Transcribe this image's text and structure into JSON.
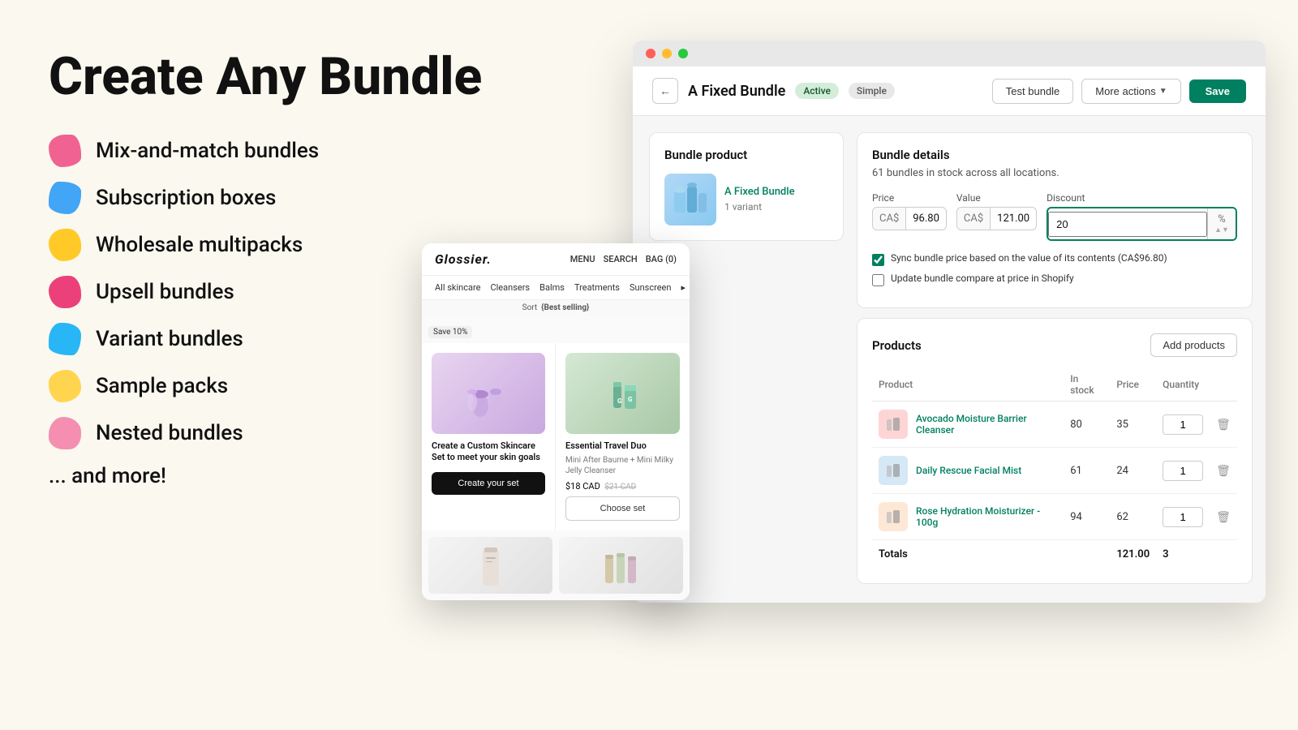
{
  "page": {
    "background_color": "#faf8ef"
  },
  "left": {
    "title": "Create Any Bundle",
    "features": [
      {
        "id": "mix-match",
        "label": "Mix-and-match bundles",
        "blob_class": "blob-pink"
      },
      {
        "id": "subscription",
        "label": "Subscription boxes",
        "blob_class": "blob-blue"
      },
      {
        "id": "wholesale",
        "label": "Wholesale multipacks",
        "blob_class": "blob-yellow"
      },
      {
        "id": "upsell",
        "label": "Upsell bundles",
        "blob_class": "blob-pink2"
      },
      {
        "id": "variant",
        "label": "Variant bundles",
        "blob_class": "blob-blue2"
      },
      {
        "id": "sample",
        "label": "Sample packs",
        "blob_class": "blob-yellow2"
      },
      {
        "id": "nested",
        "label": "Nested bundles",
        "blob_class": "blob-pink3"
      }
    ],
    "more_text": "... and more!"
  },
  "browser": {
    "window_dots": [
      "red",
      "yellow",
      "green"
    ]
  },
  "admin": {
    "title": "A Fixed Bundle",
    "badge_active": "Active",
    "badge_simple": "Simple",
    "btn_test": "Test bundle",
    "btn_more": "More actions",
    "btn_save": "Save",
    "bundle_product_section": {
      "title": "Bundle product",
      "product_name": "A Fixed Bundle",
      "product_variant": "1 variant"
    },
    "bundle_details": {
      "title": "Bundle details",
      "stock_info": "61 bundles in stock across all locations.",
      "price_label": "Price",
      "price_currency": "CA$",
      "price_value": "96.80",
      "value_label": "Value",
      "value_currency": "CA$",
      "value_value": "121.00",
      "discount_label": "Discount",
      "discount_value": "20",
      "discount_suffix": "%",
      "checkbox1_label": "Sync bundle price based on the value of its contents (CA$96.80)",
      "checkbox2_label": "Update bundle compare at price in Shopify"
    },
    "products": {
      "title": "Products",
      "btn_add": "Add products",
      "columns": [
        "Product",
        "In stock",
        "Price",
        "Quantity"
      ],
      "items": [
        {
          "name": "Avocado Moisture Barrier Cleanser",
          "in_stock": "80",
          "price": "35",
          "quantity": "1",
          "thumb_color": "#fdd5d5"
        },
        {
          "name": "Daily Rescue Facial Mist",
          "in_stock": "61",
          "price": "24",
          "quantity": "1",
          "thumb_color": "#d5e8f5"
        },
        {
          "name": "Rose Hydration Moisturizer - 100g",
          "in_stock": "94",
          "price": "62",
          "quantity": "1",
          "thumb_color": "#fde8d5"
        }
      ],
      "totals_label": "Totals",
      "totals_price": "121.00",
      "totals_qty": "3"
    }
  },
  "store_preview": {
    "logo": "Glossier.",
    "nav_links": [
      "MENU",
      "SEARCH",
      "BAG (0)"
    ],
    "categories": [
      "All skincare",
      "Cleansers",
      "Balms",
      "Treatments",
      "Sunscreen",
      "▸"
    ],
    "sort_label": "Sort",
    "sort_value": "Best selling",
    "save_badge": "Save 10%",
    "product1": {
      "title": "Create a Custom Skincare Set to meet your skin goals",
      "button": "Create your set"
    },
    "product2": {
      "title": "Essential Travel Duo",
      "subtitle": "Mini After Baume + Mini Milky Jelly Cleanser",
      "price": "$18 CAD",
      "price_old": "$21 CAD",
      "button": "Choose set"
    }
  }
}
